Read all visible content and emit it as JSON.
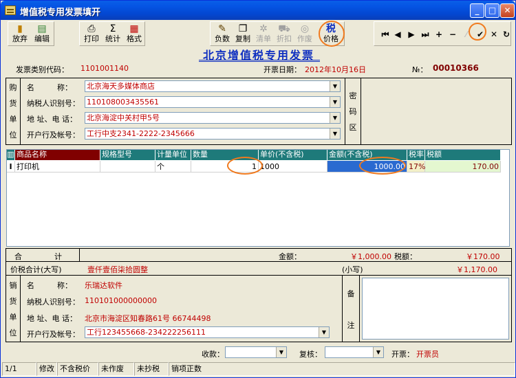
{
  "window": {
    "title": "增值税专用发票填开"
  },
  "toolbar": {
    "abandon": "放弃",
    "edit": "编辑",
    "print": "打印",
    "stats": "统计",
    "format": "格式",
    "negative": "负数",
    "copy": "复制",
    "list": "清单",
    "discount": "折扣",
    "void": "作废",
    "tax_price_top": "税",
    "tax_price": "价格"
  },
  "nav": {
    "first": "⏮",
    "prev": "◀",
    "next": "▶",
    "last": "⏭",
    "add": "+",
    "remove": "−",
    "edit": "⁄",
    "confirm": "✔",
    "cancel": "✕",
    "refresh": "↻"
  },
  "invoice": {
    "title": "北京增值税专用发票",
    "type_code_label": "发票类别代码：",
    "type_code": "1101001140",
    "date_label": "开票日期：",
    "date": "2012年10月16日",
    "number_label": "№：",
    "number": "00010366"
  },
  "buyer": {
    "section_chars": [
      "购",
      "货",
      "单",
      "位"
    ],
    "name_label": "名　　　称：",
    "name": "北京海天多媒体商店",
    "tax_id_label": "纳税人识别号：",
    "tax_id": "110108003435561",
    "address_label": "地 址、电 话：",
    "address": "北京海淀中关村甲5号",
    "bank_label": "开户行及帐号：",
    "bank": "工行中支2341-2222-2345666",
    "password_chars": [
      "密",
      "码",
      "区"
    ]
  },
  "table": {
    "headers": [
      "商品名称",
      "规格型号",
      "计量单位",
      "数量",
      "单价(不含税)",
      "金额(不含税)",
      "税率",
      "税额"
    ],
    "row_marker": "I",
    "rows": [
      {
        "name": "打印机",
        "spec": "",
        "unit": "个",
        "qty": "1",
        "price": "1000",
        "amount": "1000.00",
        "rate": "17%",
        "tax": "170.00"
      }
    ]
  },
  "totals": {
    "sum_label_1": "合",
    "sum_label_2": "计",
    "amount_label": "金额：",
    "amount": "￥1,000.00",
    "tax_label": "税额：",
    "tax": "￥170.00",
    "total_words_label": "价税合计(大写)",
    "total_words": "壹仟壹佰柒拾圆整",
    "small_label": "(小写)",
    "total_small": "￥1,170.00"
  },
  "seller": {
    "section_chars": [
      "销",
      "货",
      "单",
      "位"
    ],
    "name_label": "名　　　称：",
    "name": "乐瑞达软件",
    "tax_id_label": "纳税人识别号：",
    "tax_id": "110101000000000",
    "address_label": "地 址、电 话：",
    "address": "北京市海淀区知春路61号 66744498",
    "bank_label": "开户行及帐号：",
    "bank": "工行123455668-234222256111",
    "remark_chars": [
      "备",
      "注"
    ]
  },
  "footer": {
    "payee_label": "收款：",
    "payee": "",
    "review_label": "复核：",
    "review": "",
    "issuer_label": "开票：",
    "issuer": "开票员"
  },
  "status": [
    "1/1",
    "修改",
    "不含税价",
    "未作废",
    "未抄税",
    "销项正数"
  ],
  "colors": {
    "title_blue": "#1030c0",
    "value_red": "#c00000",
    "header_teal": "#1e7a7a",
    "header_darkred": "#800000",
    "highlight_circle": "#f07a1e"
  }
}
